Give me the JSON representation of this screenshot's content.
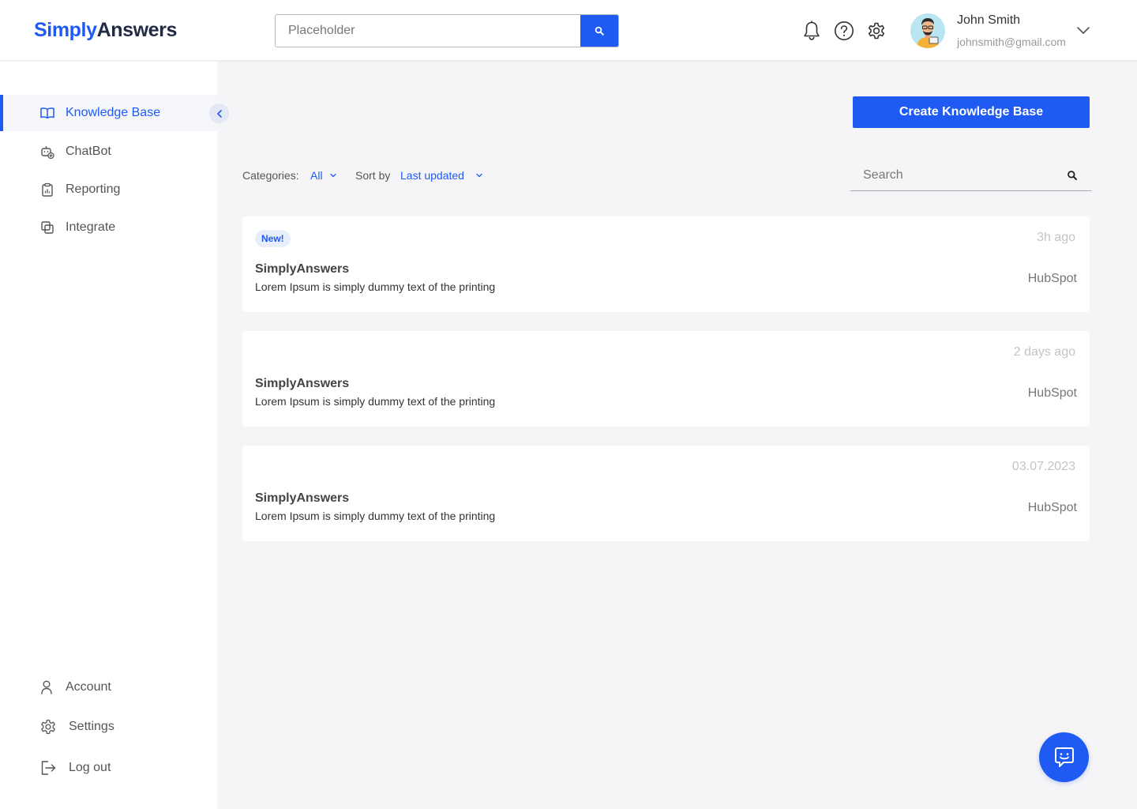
{
  "header": {
    "logo_part1": "Simply",
    "logo_part2": "Answers",
    "search_placeholder": "Placeholder",
    "icons": [
      "bell-icon",
      "help-icon",
      "gear-icon",
      "search-icon",
      "chevron-down-icon"
    ],
    "user": {
      "name": "John Smith",
      "email": "johnsmith@gmail.com"
    }
  },
  "sidebar": {
    "items": [
      {
        "label": "Knowledge Base",
        "icon": "book-icon",
        "active": true
      },
      {
        "label": "ChatBot",
        "icon": "chatbot-icon",
        "active": false
      },
      {
        "label": "Reporting",
        "icon": "clipboard-chart-icon",
        "active": false
      },
      {
        "label": "Integrate",
        "icon": "integrate-icon",
        "active": false
      }
    ],
    "bottom_items": [
      {
        "label": "Account",
        "icon": "user-icon"
      },
      {
        "label": "Settings",
        "icon": "gear-icon"
      },
      {
        "label": "Log out",
        "icon": "logout-icon"
      }
    ]
  },
  "main": {
    "create_button": "Create Knowledge Base",
    "filters": {
      "categories_label": "Categories:",
      "categories_value": "All",
      "sort_label": "Sort by",
      "sort_value": "Last updated"
    },
    "search_placeholder": "Search",
    "cards": [
      {
        "badge": "New!",
        "time": "3h ago",
        "title": "SimplyAnswers",
        "description": "Lorem Ipsum is simply dummy text of the printing",
        "source": "HubSpot"
      },
      {
        "badge": "",
        "time": "2 days  ago",
        "title": "SimplyAnswers",
        "description": "Lorem Ipsum is simply dummy text of the printing",
        "source": "HubSpot"
      },
      {
        "badge": "",
        "time": "03.07.2023",
        "title": "SimplyAnswers",
        "description": "Lorem Ipsum is simply dummy text of the printing",
        "source": "HubSpot"
      }
    ]
  },
  "colors": {
    "accent": "#1f5af2",
    "background": "#f5f5f7",
    "text": "#333333",
    "muted": "#c4c4c8"
  }
}
